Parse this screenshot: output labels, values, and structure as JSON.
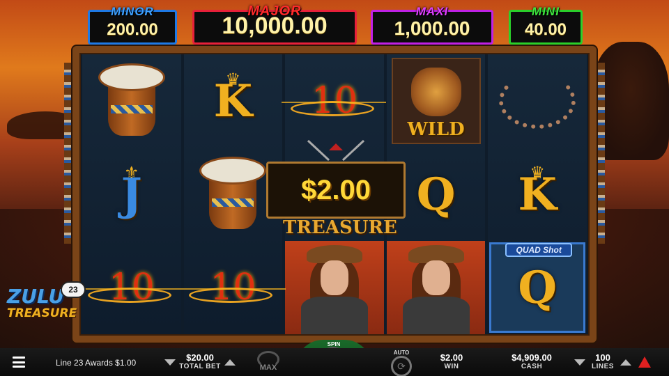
{
  "jackpots": {
    "minor": {
      "label": "MINOR",
      "value": "200.00"
    },
    "major": {
      "label": "MAJOR",
      "value": "10,000.00"
    },
    "maxi": {
      "label": "MAXI",
      "value": "1,000.00"
    },
    "mini": {
      "label": "MINI",
      "value": "40.00"
    }
  },
  "reels": {
    "r1": {
      "top": "drum-icon",
      "mid": "J",
      "bottom": "10"
    },
    "r2": {
      "top": "K",
      "mid": "drum-icon",
      "bottom": "10"
    },
    "r3": {
      "top": "10",
      "bottom": "heroine-icon"
    },
    "r4": {
      "top_wild_label": "WILD",
      "mid": "Q",
      "bottom": "heroine-icon"
    },
    "r5": {
      "top": "necklace-icon",
      "mid": "K",
      "bottom": "Q",
      "bottom_tag": "QUAD Shot"
    }
  },
  "win_popup": {
    "amount": "$2.00"
  },
  "treasure_banner": "TREASURE",
  "logo": {
    "line1": "ZULU",
    "line2": "TREASURE"
  },
  "line_badge": "23",
  "bottom": {
    "message": "Line 23 Awards $1.00",
    "total_bet_value": "$20.00",
    "total_bet_label": "TOTAL BET",
    "max_label": "MAX",
    "spin_label": "SPIN",
    "auto_label": "AUTO",
    "win_value": "$2.00",
    "win_label": "WIN",
    "cash_value": "$4,909.00",
    "cash_label": "CASH",
    "lines_value": "100",
    "lines_label": "LINES"
  },
  "colors": {
    "minor": "#1e7ae6",
    "major": "#e8203a",
    "maxi": "#c020e6",
    "mini": "#2ad02a",
    "win_gold": "#ffd838"
  }
}
